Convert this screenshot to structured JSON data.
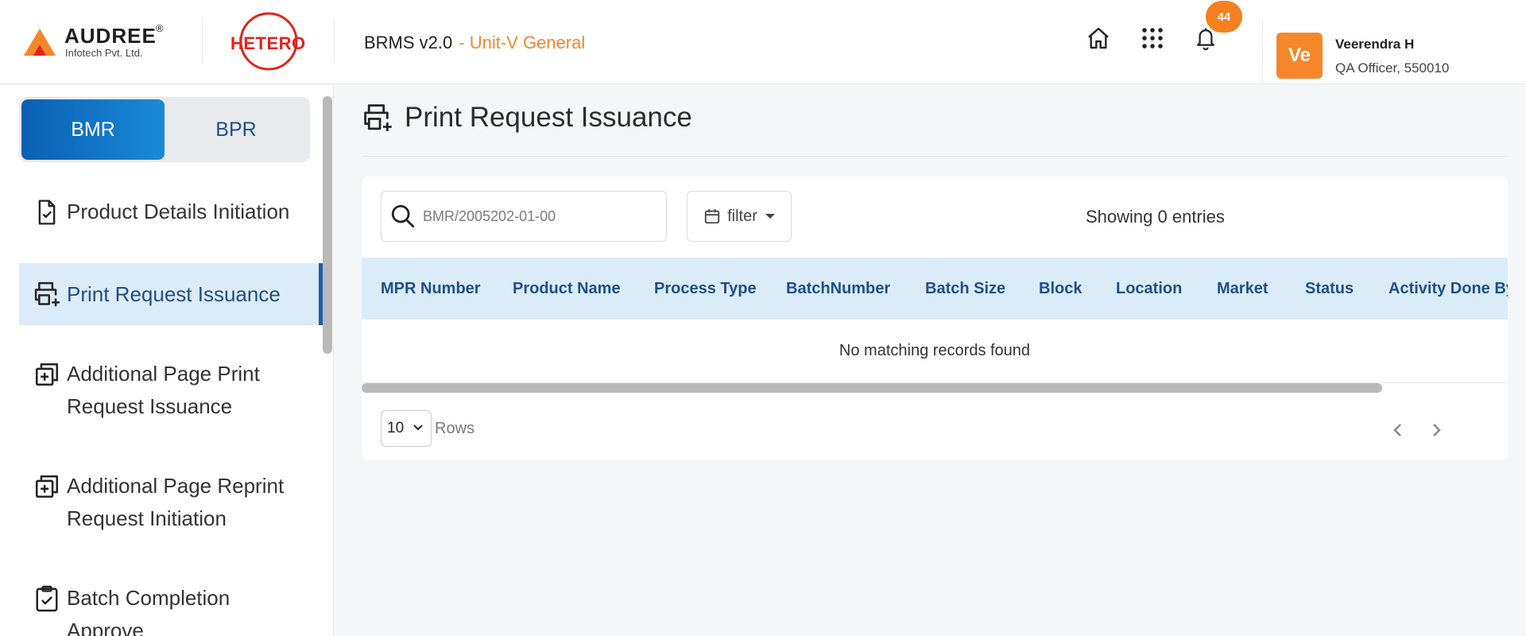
{
  "header": {
    "brand": {
      "name": "AUDREE",
      "reg": "®",
      "subtitle": "Infotech Pvt. Ltd."
    },
    "partner_logo_text": "HETERO",
    "app_name": "BRMS v2.0",
    "unit": "- Unit-V General",
    "notification_count": "44",
    "user": {
      "initials": "Ve",
      "name": "Veerendra H",
      "role": "QA Officer, 550010"
    },
    "icons": [
      "home-icon",
      "apps-grid-icon",
      "bell-icon"
    ]
  },
  "sidebar": {
    "toggle": {
      "bmr": "BMR",
      "bpr": "BPR",
      "active": "BMR"
    },
    "items": [
      {
        "label": "Product Details Initiation",
        "icon": "file-check-icon",
        "active": false
      },
      {
        "label": "Print Request Issuance",
        "icon": "printer-plus-icon",
        "active": true
      },
      {
        "label": "Additional Page Print Request Issuance",
        "icon": "add-page-icon",
        "active": false
      },
      {
        "label": "Additional Page Reprint Request Initiation",
        "icon": "add-page-icon",
        "active": false
      },
      {
        "label": "Batch Completion Approve",
        "icon": "clipboard-check-icon",
        "active": false
      }
    ]
  },
  "main": {
    "title": "Print Request Issuance",
    "search": {
      "placeholder": "BMR/2005202-01-00",
      "value": ""
    },
    "filter_label": "filter",
    "showing_text": "Showing 0 entries",
    "columns": [
      "MPR Number",
      "Product Name",
      "Process Type",
      "BatchNumber",
      "Batch Size",
      "Block",
      "Location",
      "Market",
      "Status",
      "Activity Done By"
    ],
    "empty_message": "No matching records found",
    "rows_per_page": "10",
    "rows_label": "Rows"
  },
  "colors": {
    "accent_orange": "#f5862a",
    "primary_blue": "#1a5fa8",
    "header_row_bg": "#dbecf9",
    "hetero_red": "#e2231a"
  }
}
